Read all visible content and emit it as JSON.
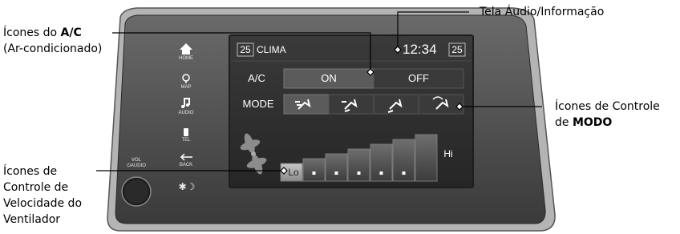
{
  "callouts": {
    "ac_icons_line1_prefix": "Ícones do ",
    "ac_icons_line1_bold": "A/C",
    "ac_icons_line2": "(Ar-condicionado)",
    "audio_info_screen": "Tela Áudio/Informação",
    "mode_icons_line1": "Ícones de Controle",
    "mode_icons_line2_prefix": "de ",
    "mode_icons_line2_bold": "MODO",
    "fan_icons_lines": [
      "Ícones de",
      "Controle de",
      "Velocidade do",
      "Ventilador"
    ]
  },
  "sidebar": {
    "home_label": "HOME",
    "map_label": "MAP",
    "audio_label": "AUDIO",
    "tel_label": "TEL",
    "back_label": "BACK",
    "vol_label_1": "VOL",
    "vol_label_2": "⏻AUDIO",
    "brightness_glyph": "✱☽"
  },
  "screen": {
    "left_temp": "25",
    "title": "CLIMA",
    "clock": "12:34",
    "right_temp": "25",
    "ac_label": "A/C",
    "ac_on": "ON",
    "ac_off": "OFF",
    "mode_label": "MODE",
    "fan_lo": "Lo",
    "fan_hi": "Hi",
    "fan_levels": 7,
    "fan_selected_level": 1
  },
  "colors": {
    "bezel_outer": "#9a9a9a",
    "bezel_inner": "#4a4a4a",
    "screen_bg": "#2e2e2e",
    "active_button": "#5a5a5a"
  }
}
